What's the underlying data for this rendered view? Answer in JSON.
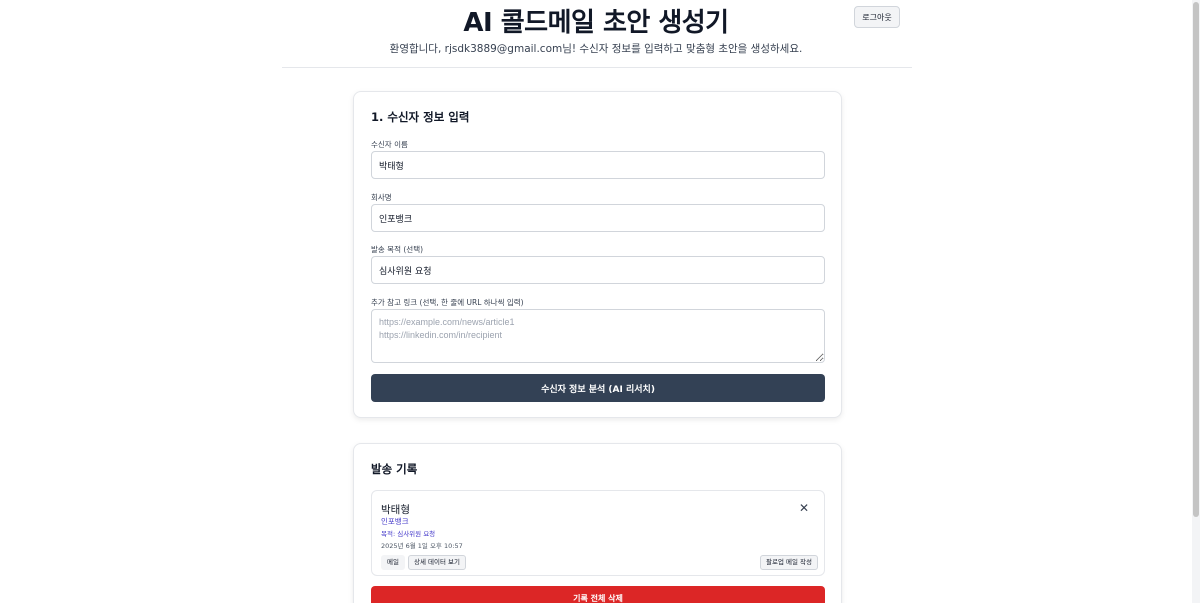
{
  "header": {
    "title": "AI 콜드메일 초안 생성기",
    "subtitle": "환영합니다, rjsdk3889@gmail.com님! 수신자 정보를 입력하고 맞춤형 초안을 생성하세요.",
    "logout_label": "로그아웃"
  },
  "form": {
    "title": "1. 수신자 정보 입력",
    "name_label": "수신자 이름",
    "name_value": "박태형",
    "company_label": "회사명",
    "company_value": "인포뱅크",
    "purpose_label": "발송 목적 (선택)",
    "purpose_value": "심사위원 요청",
    "links_label": "추가 참고 링크 (선택, 한 줄에 URL 하나씩 입력)",
    "links_placeholder": "https://example.com/news/article1\nhttps://linkedin.com/in/recipient",
    "analyze_label": "수신자 정보 분석 (AI 리서치)"
  },
  "history": {
    "title": "발송 기록",
    "items": [
      {
        "name": "박태형",
        "company": "인포뱅크",
        "purpose": "목적: 심사위원 요청",
        "date": "2025년 6월 1일 오후 10:57",
        "mail_tag": "메일",
        "detail_label": "상세 데이터 보기",
        "followup_label": "팔로업 메일 작성"
      }
    ],
    "delete_all_label": "기록 전체 삭제"
  },
  "colors": {
    "primary_button": "#334155",
    "danger_button": "#dc2626",
    "accent_text": "#4338ca"
  }
}
